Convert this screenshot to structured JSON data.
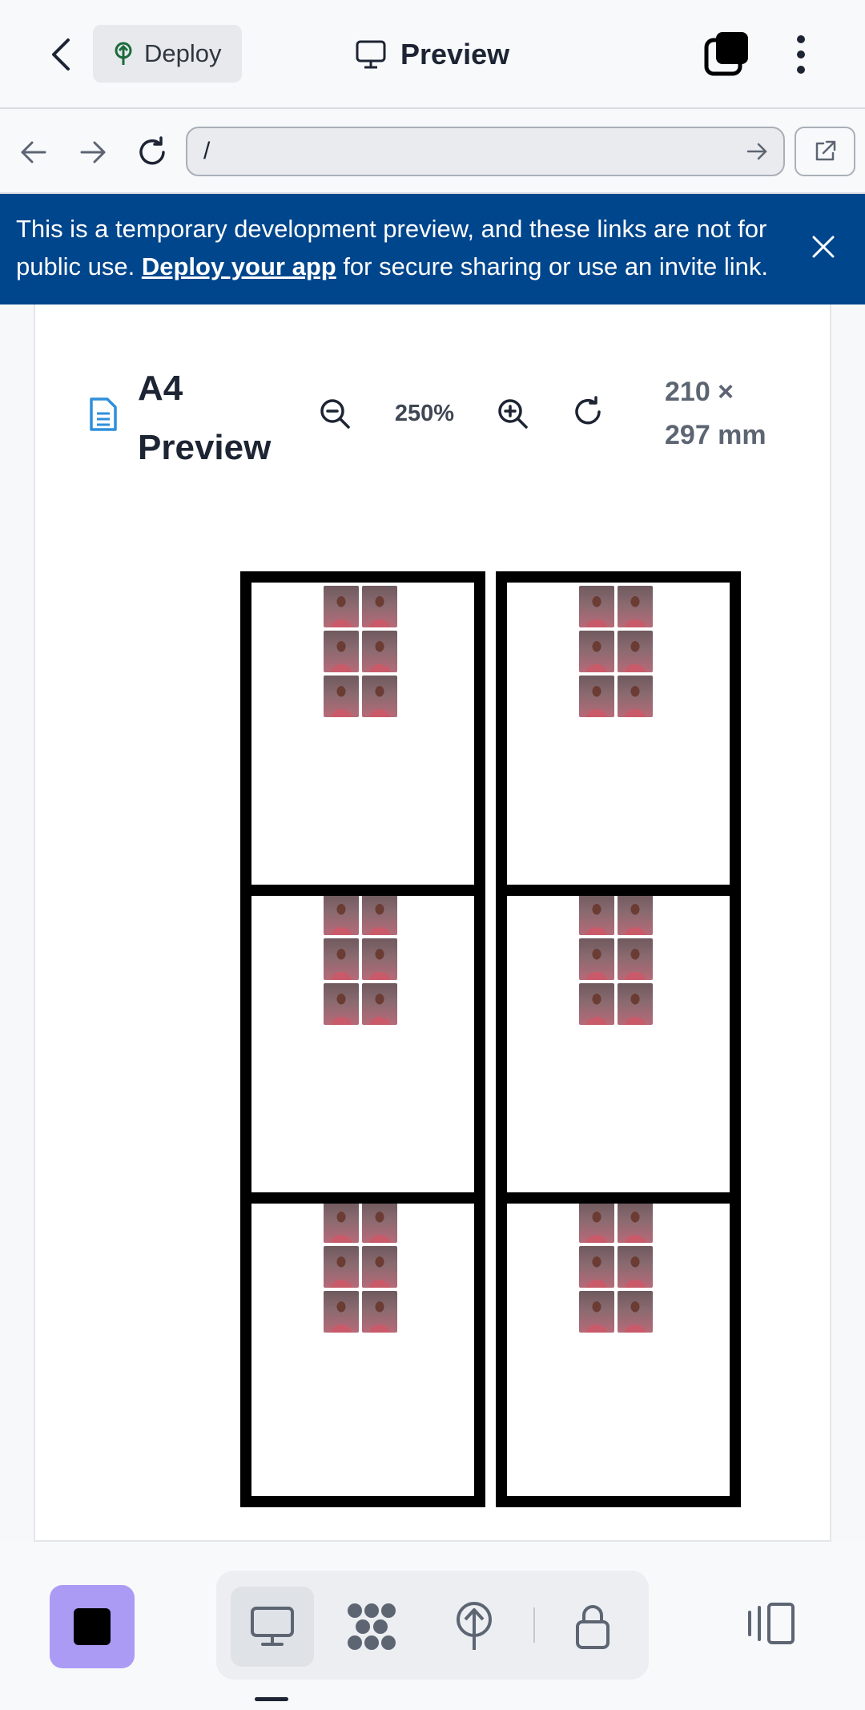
{
  "topbar": {
    "deploy_label": "Deploy",
    "title": "Preview"
  },
  "urlbar": {
    "value": "/"
  },
  "banner": {
    "text_before": "This is a temporary development preview, and these links are not for public use. ",
    "link_label": "Deploy your app",
    "text_after": " for secure sharing or use an invite link."
  },
  "preview": {
    "title_line1": "A4",
    "title_line2": "Preview",
    "zoom": "250%",
    "dims_line1": "210 ×",
    "dims_line2": "297 mm"
  },
  "sheet": {
    "columns": 2,
    "rows_per_column": 3,
    "photos_per_cell": 6
  },
  "icons": {
    "back": "chevron-left-icon",
    "deploy": "deploy-tree-icon",
    "preview": "monitor-icon",
    "tabs": "tabs-icon",
    "menu": "more-vertical-icon",
    "nav_back": "arrow-left-icon",
    "nav_forward": "arrow-right-icon",
    "reload": "reload-icon",
    "go": "arrow-right-icon",
    "external": "external-link-icon",
    "close": "close-icon",
    "doc": "document-icon",
    "zoom_out": "zoom-out-icon",
    "zoom_in": "zoom-in-icon",
    "reset": "refresh-icon"
  },
  "colors": {
    "banner_bg": "#00468c",
    "stop_button": "#ab9bf5",
    "doc_icon": "#2f8fdc"
  }
}
